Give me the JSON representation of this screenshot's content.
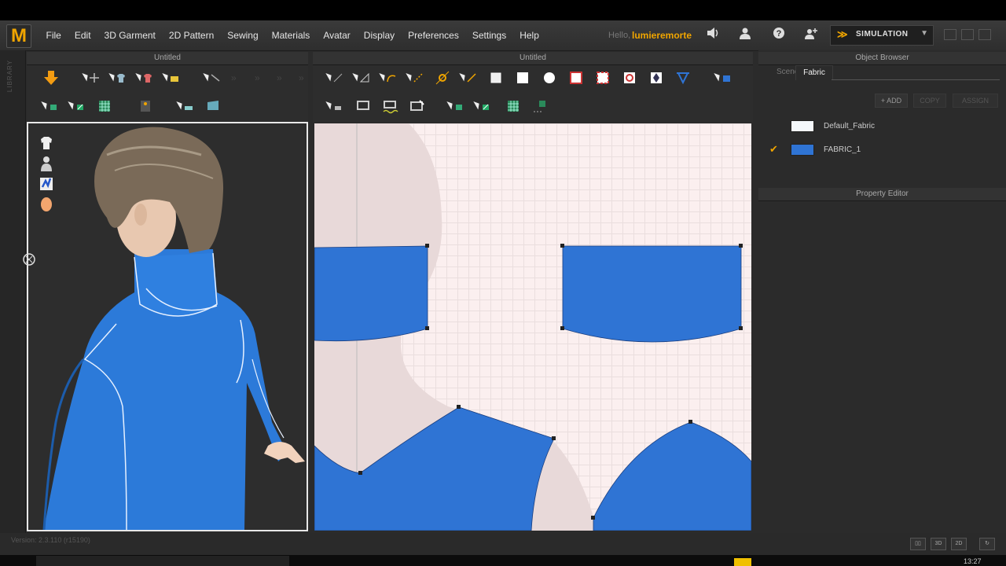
{
  "menu": {
    "logo": "M",
    "items": [
      "File",
      "Edit",
      "3D Garment",
      "2D Pattern",
      "Sewing",
      "Materials",
      "Avatar",
      "Display",
      "Preferences",
      "Settings",
      "Help"
    ],
    "hello": "Hello,",
    "username": "lumieremorte",
    "simulation_label": "SIMULATION"
  },
  "sidebar": {
    "label": "LIBRARY"
  },
  "panels": {
    "left_title": "Untitled",
    "center_title": "Untitled",
    "object_browser_title": "Object Browser",
    "property_editor_title": "Property Editor"
  },
  "object_browser": {
    "tabs": [
      "Scene",
      "Fabric"
    ],
    "active_tab": "Fabric",
    "actions": [
      "+ ADD",
      "COPY",
      "ASSIGN"
    ],
    "fabrics": [
      {
        "name": "Default_Fabric",
        "color": "#f4f8fb",
        "checked": false
      },
      {
        "name": "FABRIC_1",
        "color": "#2f74d4",
        "checked": true
      }
    ]
  },
  "status": {
    "version": "Version: 2.3.110    (r15190)",
    "clock": "13:27",
    "view_buttons": [
      "3D",
      "2D"
    ]
  },
  "colors": {
    "accent": "#f0a500",
    "fabric": "#2f74d4",
    "pattern_bg": "#fbefef"
  }
}
